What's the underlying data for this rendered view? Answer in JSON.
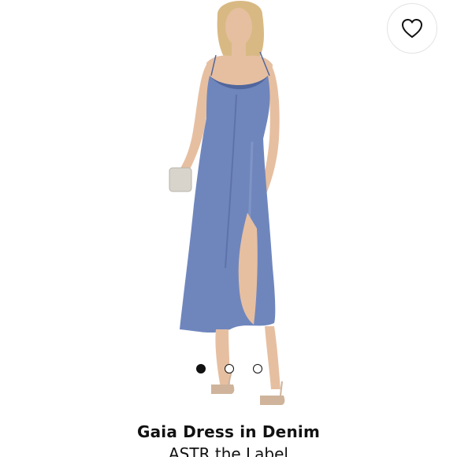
{
  "product": {
    "name": "Gaia Dress in Denim",
    "brand": "ASTR the Label",
    "color_dress": "#6f86bd",
    "color_dress_shadow": "#51669c",
    "color_skin": "#e6bfa1",
    "color_hair": "#d9b983"
  },
  "wishlist": {
    "icon": "heart-outline-icon"
  },
  "carousel": {
    "total_images": 3,
    "active_index": 0
  }
}
